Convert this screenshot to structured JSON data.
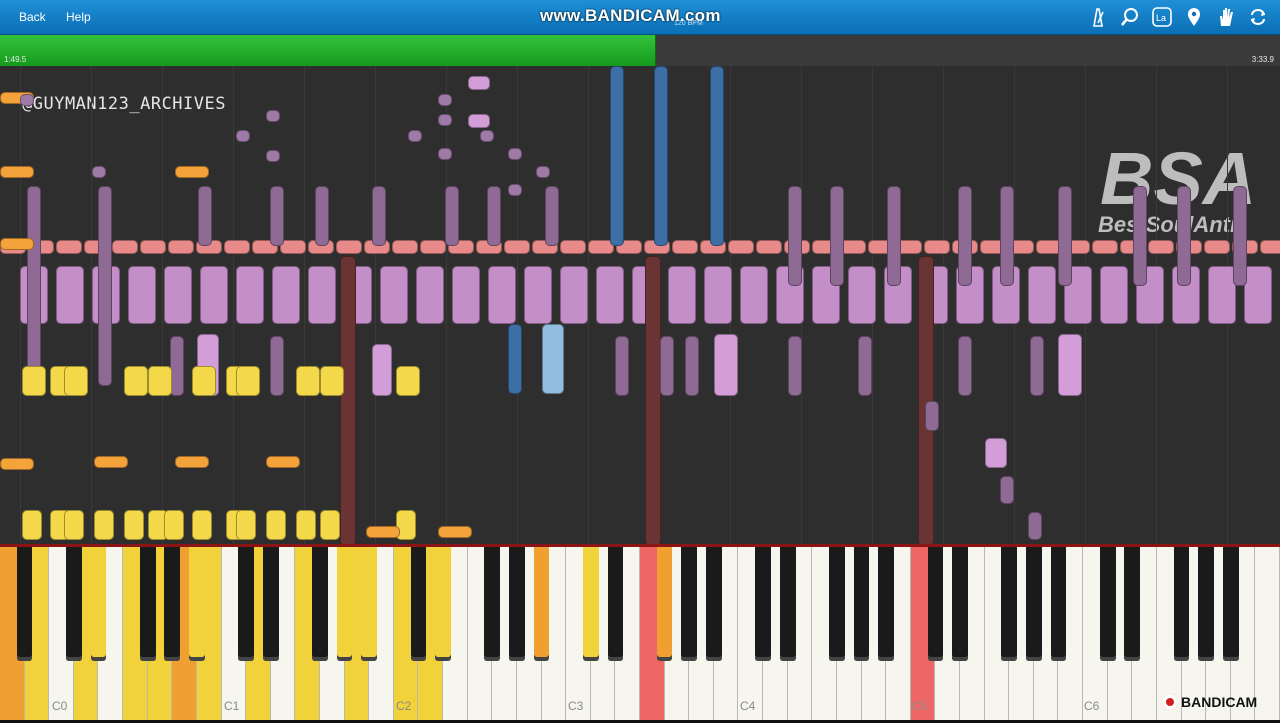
{
  "toolbar": {
    "back_label": "Back",
    "help_label": "Help",
    "watermark": "www.BANDICAM.com",
    "bpm_text": "120 BPM",
    "icons": [
      "metronome-icon",
      "zoom-icon",
      "la-icon",
      "location-pin-icon",
      "hand-icon",
      "loop-icon"
    ]
  },
  "playback": {
    "elapsed": "1:49.5",
    "total": "3:33.9",
    "progress_fraction": 0.512,
    "progress_color": "#2fb636"
  },
  "overlay": {
    "handle": "@GUYMAN123_ARCHIVES",
    "logo_big": "BSA",
    "logo_small": "BestSoulAnti"
  },
  "keyboard": {
    "octave_labels": [
      "C0",
      "C1",
      "C2",
      "C3",
      "C4",
      "C5",
      "C6"
    ],
    "highlight_colors": {
      "yellow": "#f2d23a",
      "orange": "#f0a030",
      "red": "#f06666",
      "purple": "#9b6aa0"
    }
  },
  "footer": {
    "brand": "BANDICAM"
  }
}
